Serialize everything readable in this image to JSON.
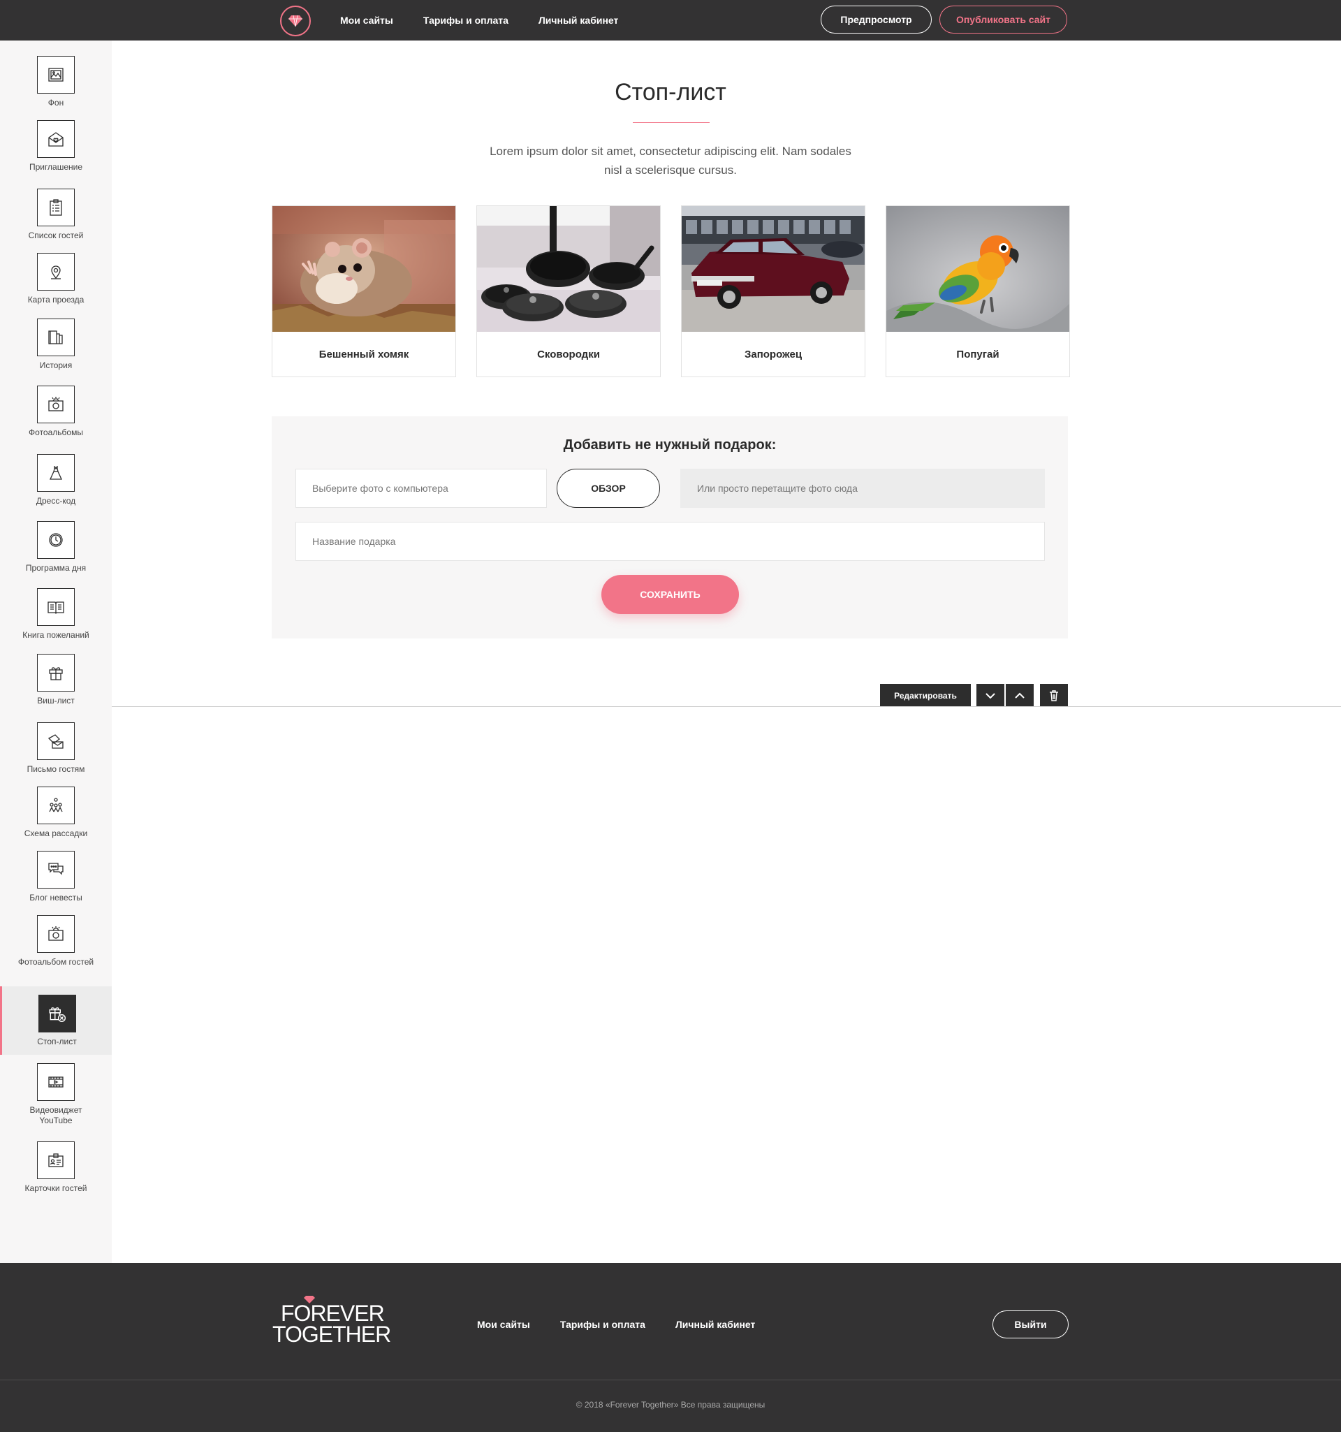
{
  "header": {
    "nav": [
      "Мои сайты",
      "Тарифы и оплата",
      "Личный кабинет"
    ],
    "preview_label": "Предпросмотр",
    "publish_label": "Опубликовать сайт"
  },
  "sidebar": {
    "items": [
      {
        "label": "Фон",
        "icon": "image-icon"
      },
      {
        "label": "Приглашение",
        "icon": "envelope-heart-icon"
      },
      {
        "label": "Список гостей",
        "icon": "clipboard-list-icon"
      },
      {
        "label": "Карта проезда",
        "icon": "map-pin-icon"
      },
      {
        "label": "История",
        "icon": "book-icon"
      },
      {
        "label": "Фотоальбомы",
        "icon": "camera-icon"
      },
      {
        "label": "Дресс-код",
        "icon": "dress-icon"
      },
      {
        "label": "Программа дня",
        "icon": "clock-icon"
      },
      {
        "label": "Книга пожеланий",
        "icon": "open-book-icon"
      },
      {
        "label": "Виш-лист",
        "icon": "gift-icon"
      },
      {
        "label": "Письмо гостям",
        "icon": "letters-icon"
      },
      {
        "label": "Схема рассадки",
        "icon": "seating-icon"
      },
      {
        "label": "Блог невесты",
        "icon": "chat-bubbles-icon"
      },
      {
        "label": "Фотоальбом гостей",
        "icon": "camera-icon"
      },
      {
        "label": "Стоп-лист",
        "icon": "gift-cancel-icon",
        "active": true
      },
      {
        "label": "Видеовиджет YouTube",
        "icon": "video-icon"
      },
      {
        "label": "Карточки гостей",
        "icon": "id-card-icon"
      }
    ]
  },
  "main": {
    "title": "Стоп-лист",
    "subtitle": "Lorem ipsum dolor sit amet, consectetur adipiscing elit. Nam sodales nisl a scelerisque cursus.",
    "cards": [
      {
        "name": "Бешенный хомяк"
      },
      {
        "name": "Сковородки"
      },
      {
        "name": "Запорожец"
      },
      {
        "name": "Попугай"
      }
    ],
    "add": {
      "heading": "Добавить не нужный подарок:",
      "file_placeholder": "Выберите фото с компьютера",
      "browse_label": "ОБЗОР",
      "drop_placeholder": "Или просто перетащите фото сюда",
      "name_placeholder": "Название подарка",
      "save_label": "СОХРАНИТЬ"
    },
    "edit_label": "Редактировать"
  },
  "footer": {
    "brand_line1": "FOREVER",
    "brand_line2": "TOGETHER",
    "nav": [
      "Мои сайты",
      "Тарифы и оплата",
      "Личный кабинет"
    ],
    "logout_label": "Выйти",
    "copyright": "© 2018 «Forever Together» Все права защищены"
  },
  "colors": {
    "accent": "#f27488",
    "dark": "#333233",
    "panel": "#f7f6f6"
  }
}
